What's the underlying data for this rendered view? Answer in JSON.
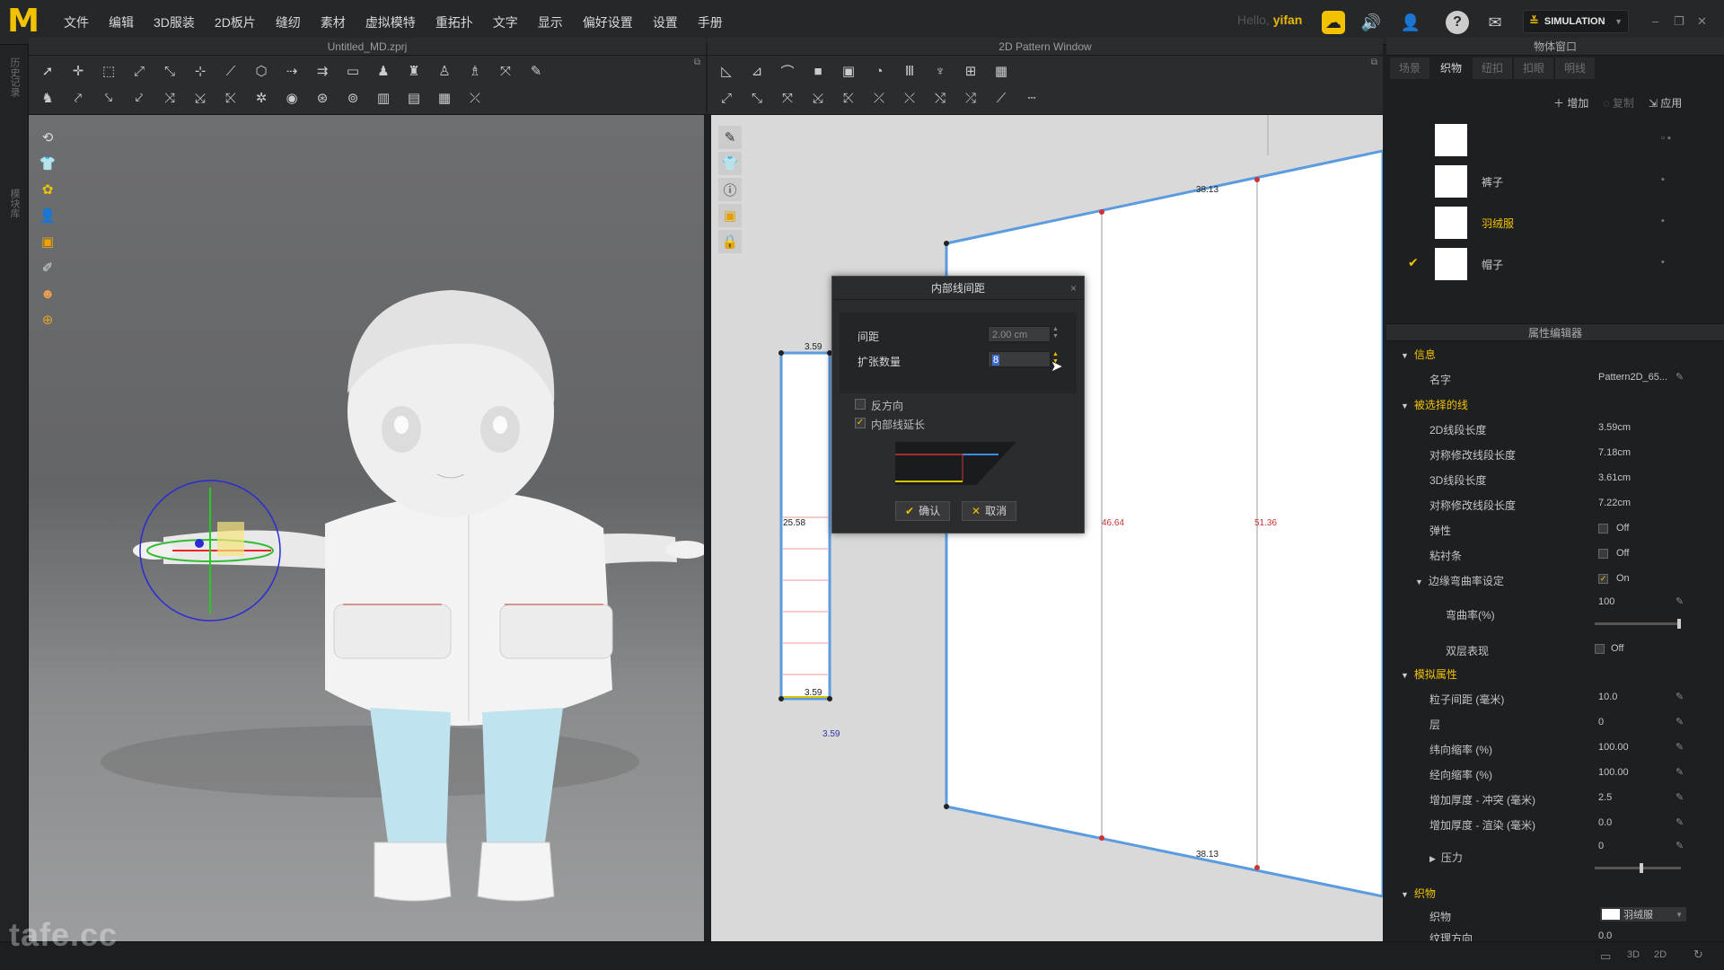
{
  "menubar": {
    "logo": "M",
    "items": [
      "文件",
      "编辑",
      "3D服装",
      "2D板片",
      "缝纫",
      "素材",
      "虚拟模特",
      "重拓扑",
      "文字",
      "显示",
      "偏好设置",
      "设置",
      "手册"
    ],
    "hello_prefix": "Hello,",
    "user": "yifan",
    "simulation_label": "SIMULATION"
  },
  "window_3d": {
    "title": "Untitled_MD.zprj"
  },
  "window_2d": {
    "title": "2D Pattern Window",
    "measurements": {
      "top_width": "38.13",
      "bottom_width": "38.13",
      "mid_left": "46.64",
      "mid_right": "51.36",
      "small_top": "3.59",
      "small_bottom": "3.59",
      "small_below": "3.59",
      "small_height": "25.58"
    }
  },
  "dialog": {
    "title": "内部线间距",
    "spacing_label": "间距",
    "spacing_value": "2.00 cm",
    "count_label": "扩张数量",
    "count_value": "8",
    "reverse_label": "反方向",
    "reverse_checked": false,
    "extend_label": "内部线延长",
    "extend_checked": true,
    "ok_label": "确认",
    "cancel_label": "取消"
  },
  "object_window": {
    "title": "物体窗口",
    "tabs": [
      "场景",
      "织物",
      "纽扣",
      "扣眼",
      "明线"
    ],
    "active_tab": "织物",
    "actions": {
      "add": "增加",
      "copy": "复制",
      "apply": "应用"
    },
    "fabrics": [
      {
        "name": "",
        "selected": false,
        "checked": false
      },
      {
        "name": "裤子",
        "selected": false,
        "checked": false
      },
      {
        "name": "羽绒服",
        "selected": true,
        "checked": false
      },
      {
        "name": "帽子",
        "selected": false,
        "checked": true
      }
    ]
  },
  "property_editor": {
    "title": "属性编辑器",
    "info_section": "信息",
    "name_label": "名字",
    "name_value": "Pattern2D_65...",
    "selected_line_section": "被选择的线",
    "len2d_label": "2D线段长度",
    "len2d_value": "3.59cm",
    "sym2d_label": "对称修改线段长度",
    "sym2d_value": "7.18cm",
    "len3d_label": "3D线段长度",
    "len3d_value": "3.61cm",
    "sym3d_label": "对称修改线段长度",
    "sym3d_value": "7.22cm",
    "elastic_label": "弹性",
    "elastic_value": "Off",
    "tape_label": "粘衬条",
    "tape_value": "Off",
    "fold_label": "边缘弯曲率设定",
    "fold_value": "On",
    "curv_label": "弯曲率(%)",
    "curv_value": "100",
    "double_label": "双层表现",
    "double_value": "Off",
    "sim_section": "模拟属性",
    "particle_label": "粒子间距 (毫米)",
    "particle_value": "10.0",
    "layer_label": "层",
    "layer_value": "0",
    "weft_label": "纬向缩率 (%)",
    "weft_value": "100.00",
    "warp_label": "经向缩率 (%)",
    "warp_value": "100.00",
    "thick_col_label": "增加厚度 - 冲突 (毫米)",
    "thick_col_value": "2.5",
    "thick_ren_label": "增加厚度 - 渲染 (毫米)",
    "thick_ren_value": "0.0",
    "pressure_label": "压力",
    "pressure_value": "0",
    "fabric_section": "织物",
    "fabric_label": "织物",
    "fabric_value": "羽绒服",
    "grain_label": "纹理方向",
    "grain_value": "0.0"
  },
  "left_strip": {
    "tab1": "历史记录",
    "tab2": "模块库"
  },
  "watermark": "tafe.cc",
  "colors": {
    "accent": "#f2c200",
    "pattern_outline": "#4a90d9"
  }
}
